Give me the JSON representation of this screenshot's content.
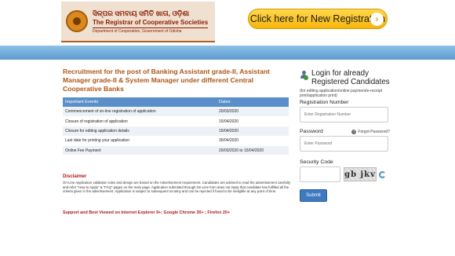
{
  "header": {
    "logo_odia": "ସିଳ୍ପର ସମବାୟ ସମିତି ଖାତା, ଓଡ଼ିଶା",
    "logo_title": "The Registrar of Cooperative Societies",
    "logo_dept": "Department of Cooperation, Government of Odisha",
    "registration_button": "Click here for New Registration",
    "registration_chevron": "›"
  },
  "main": {
    "title": "Recruitment for the post of Banking Assistant grade-II, Assistant Manager grade-II & System Manager under different Central Cooperative Banks",
    "table": {
      "headers": [
        "Important Events",
        "Dates"
      ],
      "rows": [
        {
          "event": "Commencement of on-line registration of application",
          "date": "20/03/2020"
        },
        {
          "event": "Closure of registration of application",
          "date": "15/04/2020"
        },
        {
          "event": "Closure for editing application details",
          "date": "15/04/2020"
        },
        {
          "event": "Last date for printing your application",
          "date": "30/04/2020"
        },
        {
          "event": "Online Fee Payment",
          "date": "20/03/2020 to 15/04/2020"
        }
      ]
    },
    "disclaimer_title": "Disclaimer",
    "disclaimer_text": "On-Line Application validation rules and design are based on the Advertisement requirement. Candidates are advised to read the advertisement carefully and refer \"How to Apply\" & \"FAQ\" pages on the main page. Application submitted through On-Line form does not imply that candidate has fulfilled all the criteria given in the advertisement. Application is subject to subsequent scrutiny and can be rejected if found to be ineligible at any point of time.",
    "support_text": "Support and Best Viewed on Internet Explorer 9+; Google Chrome 30+ ; Firefox 20+"
  },
  "login": {
    "title": "Login for already Registered Candidates",
    "subtitle": "(for editing application/online payment/e-receipt print/application print)",
    "registration_label": "Registration Number",
    "registration_placeholder": "Enter Registration Number",
    "password_label": "Password",
    "forgot_label": "Forgot Password?",
    "password_placeholder": "Enter Password",
    "security_label": "Security Code",
    "captcha_text": "gb jkv",
    "submit_label": "Submit"
  },
  "colors": {
    "title_orange": "#b05515",
    "table_header": "#5a8fca",
    "registration_button": "#f5b50a",
    "submit_button": "#3e79c1",
    "bluebar": "#6fa8d8"
  }
}
